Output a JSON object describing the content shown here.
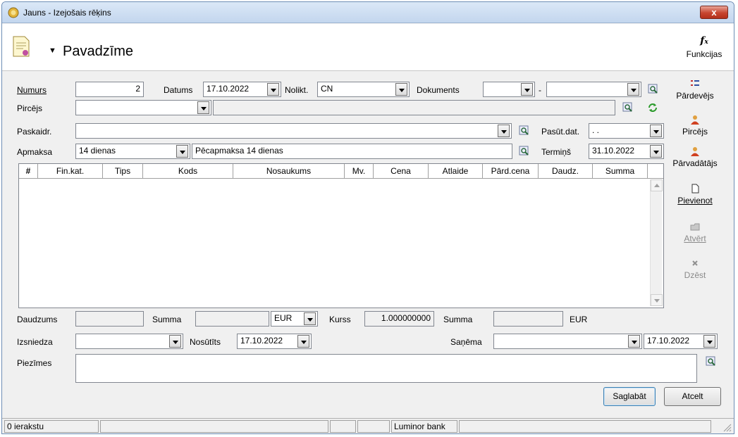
{
  "window": {
    "title": "Jauns - Izejošais rēķins",
    "close_label": "x"
  },
  "header": {
    "title": "Pavadzīme",
    "functions_label": "Funkcijas",
    "functions_icon": "fx-icon"
  },
  "form": {
    "numurs_label": "Numurs",
    "numurs_value": "2",
    "datums_label": "Datums",
    "datums_value": "17.10.2022",
    "nolikt_label": "Nolikt.",
    "nolikt_value": "CN",
    "dokuments_label": "Dokuments",
    "dokuments_value1": "",
    "dokuments_sep": "-",
    "dokuments_value2": "",
    "pircejs_label": "Pircējs",
    "pircejs_code": "",
    "pircejs_name": "",
    "paskaidr_label": "Paskaidr.",
    "paskaidr_value": "",
    "pasut_dat_label": "Pasūt.dat.",
    "pasut_dat_value": ". .",
    "apmaksa_label": "Apmaksa",
    "apmaksa_value": "14 dienas",
    "apmaksa_desc": "Pēcapmaksa 14 dienas",
    "termins_label": "Termiņš",
    "termins_value": "31.10.2022"
  },
  "table": {
    "columns": [
      "#",
      "Fin.kat.",
      "Tips",
      "Kods",
      "Nosaukums",
      "Mv.",
      "Cena",
      "Atlaide",
      "Pārd.cena",
      "Daudz.",
      "Summa"
    ],
    "rows": []
  },
  "side": {
    "pardevejs": "Pārdevējs",
    "pircejs": "Pircējs",
    "parvadatajs": "Pārvadātājs",
    "pievienot": "Pievienot",
    "atvert": "Atvērt",
    "dzest": "Dzēst"
  },
  "totals": {
    "daudzums_label": "Daudzums",
    "daudzums_value": "",
    "summa_label": "Summa",
    "summa_value": "",
    "currency_value": "EUR",
    "kurss_label": "Kurss",
    "kurss_value": "1.000000000",
    "summa2_label": "Summa",
    "summa2_value": "",
    "currency2": "EUR"
  },
  "bottom": {
    "izsniedza_label": "Izsniedza",
    "izsniedza_value": "",
    "nosutits_label": "Nosūtīts",
    "nosutits_value": "17.10.2022",
    "sanema_label": "Saņēma",
    "sanema_value": "",
    "sanema_date": "17.10.2022",
    "piezimes_label": "Piezīmes",
    "piezimes_value": ""
  },
  "buttons": {
    "save": "Saglabāt",
    "cancel": "Atcelt"
  },
  "status": {
    "records": "0 ierakstu",
    "bank": "Luminor bank"
  }
}
